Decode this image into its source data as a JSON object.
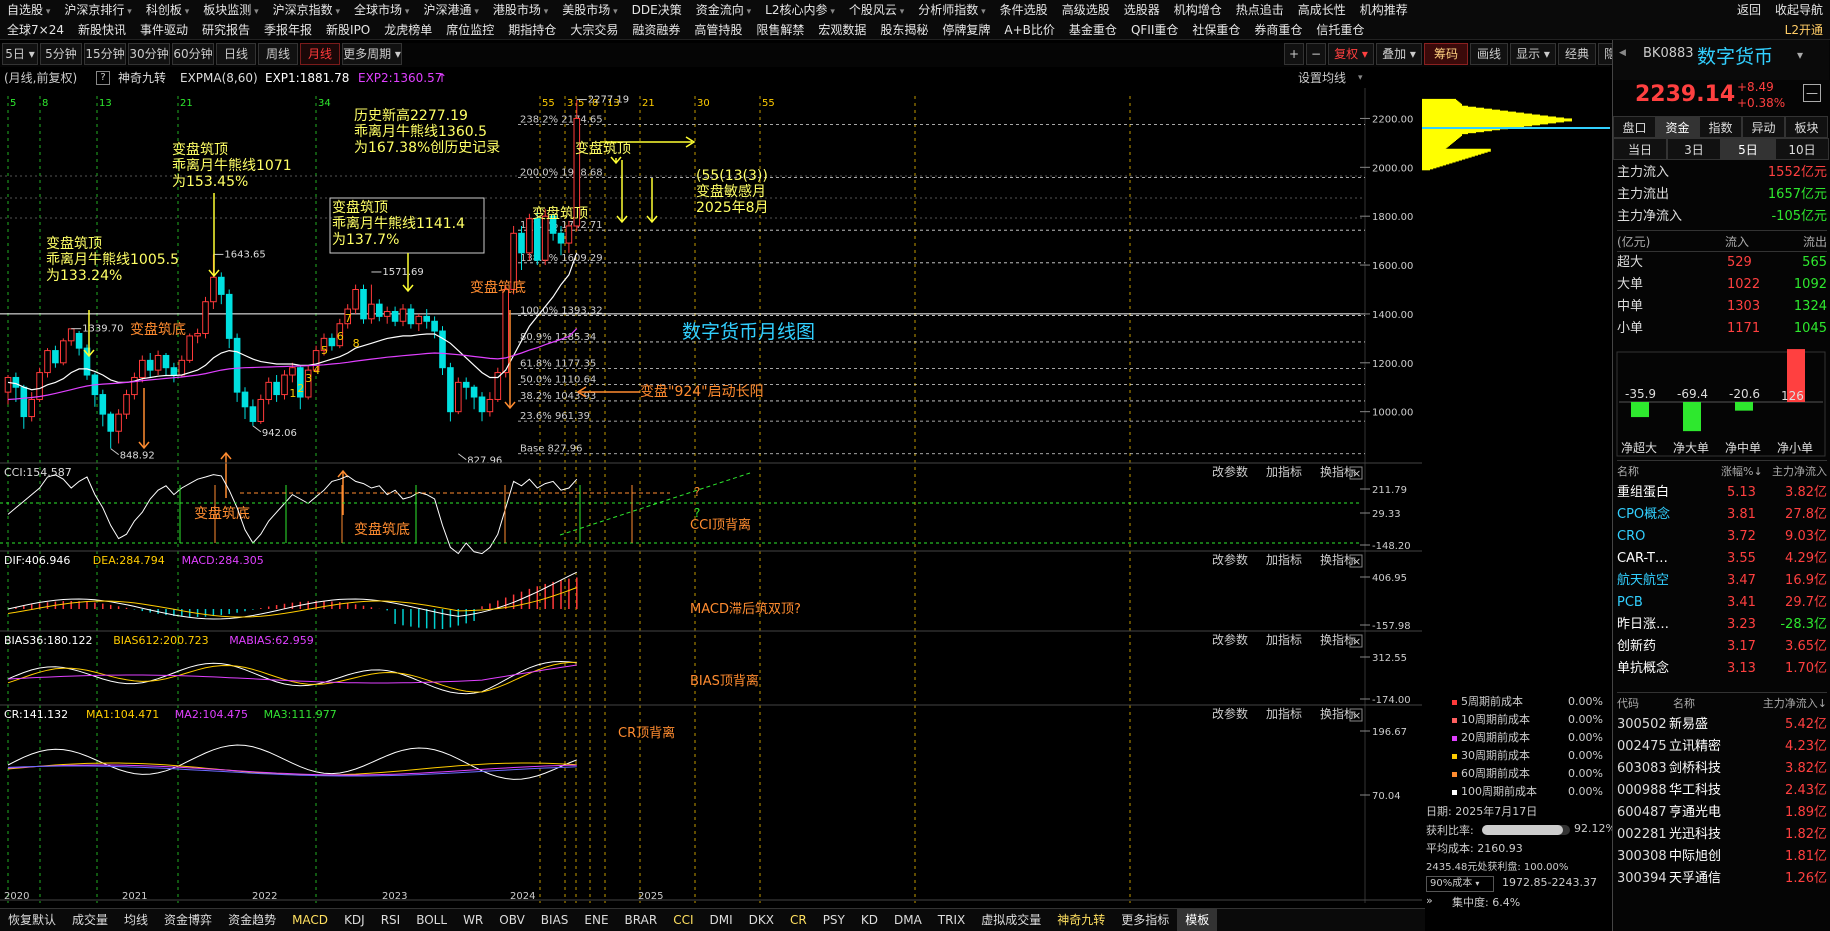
{
  "topmenu": {
    "row1": [
      "自选股",
      "沪深京排行",
      "科创板",
      "板块监测",
      "沪深京指数",
      "全球市场",
      "沪深港通",
      "港股市场",
      "美股市场",
      "DDE决策",
      "资金流向",
      "L2核心内参",
      "个股风云",
      "分析师指数",
      "条件选股",
      "高级选股",
      "选股器",
      "机构增仓",
      "热点追击",
      "高成长性",
      "机构推荐",
      "收起导航",
      "返回"
    ],
    "row2": [
      "全球7×24",
      "新股快讯",
      "事件驱动",
      "研究报告",
      "季报年报",
      "新股IPO",
      "龙虎榜单",
      "席位监控",
      "期指持仓",
      "大宗交易",
      "融资融券",
      "高管持股",
      "限售解禁",
      "宏观数据",
      "股东揭秘",
      "停牌复牌",
      "A+B比价",
      "基金重仓",
      "QFII重仓",
      "社保重仓",
      "券商重仓",
      "信托重仓",
      "L2开通"
    ],
    "row1_arrows": [
      0,
      1,
      2,
      3,
      4,
      5,
      6,
      7,
      8,
      10,
      11,
      12,
      13
    ]
  },
  "toolbar": {
    "periods": [
      "5日",
      "5分钟",
      "15分钟",
      "30分钟",
      "60分钟",
      "日线",
      "周线",
      "月线",
      "更多周期"
    ],
    "active_period": "月线",
    "right": [
      "+",
      "−",
      "复权",
      "叠加",
      "筹码",
      "画线",
      "显示",
      "经典",
      "隐藏"
    ],
    "right_active": "筹码"
  },
  "header": {
    "mode": "(月线,前复权)",
    "question": "?",
    "indicator": "神奇九转",
    "expma": "EXPMA(8,60)",
    "exp1": "EXP1:1881.78",
    "exp2": "EXP2:1360.57",
    "settings": "设置均线"
  },
  "chart_data": {
    "type": "candlestick",
    "title": "数字货币月线图",
    "xlabel_ticks": [
      "2020",
      "2021",
      "2022",
      "2023",
      "2024",
      "2025"
    ],
    "y_ticks": [
      "2200.00",
      "2000.00",
      "1800.00",
      "1600.00",
      "1400.00",
      "1200.00",
      "1000.00"
    ],
    "ylim": [
      790,
      2300
    ],
    "price_line": 1400,
    "candles": [
      [
        1080,
        1140,
        1030,
        1150
      ],
      [
        1140,
        1100,
        1040,
        1160
      ],
      [
        1100,
        980,
        930,
        1110
      ],
      [
        980,
        1050,
        960,
        1080
      ],
      [
        1050,
        1160,
        1040,
        1180
      ],
      [
        1160,
        1250,
        1140,
        1260
      ],
      [
        1250,
        1200,
        1180,
        1270
      ],
      [
        1200,
        1290,
        1190,
        1300
      ],
      [
        1290,
        1339,
        1270,
        1340
      ],
      [
        1320,
        1260,
        1230,
        1330
      ],
      [
        1260,
        1150,
        1130,
        1275
      ],
      [
        1150,
        1070,
        1020,
        1160
      ],
      [
        1070,
        990,
        940,
        1090
      ],
      [
        990,
        920,
        850,
        1000
      ],
      [
        920,
        990,
        870,
        1010
      ],
      [
        990,
        1070,
        970,
        1090
      ],
      [
        1070,
        1140,
        1050,
        1160
      ],
      [
        1140,
        1210,
        1120,
        1230
      ],
      [
        1210,
        1170,
        1140,
        1240
      ],
      [
        1170,
        1230,
        1150,
        1250
      ],
      [
        1230,
        1180,
        1150,
        1240
      ],
      [
        1180,
        1150,
        1120,
        1200
      ],
      [
        1150,
        1210,
        1140,
        1230
      ],
      [
        1210,
        1310,
        1200,
        1320
      ],
      [
        1310,
        1320,
        1280,
        1340
      ],
      [
        1320,
        1450,
        1300,
        1470
      ],
      [
        1450,
        1550,
        1420,
        1643
      ],
      [
        1550,
        1480,
        1440,
        1570
      ],
      [
        1480,
        1300,
        1260,
        1500
      ],
      [
        1300,
        1080,
        1040,
        1320
      ],
      [
        1080,
        1020,
        970,
        1100
      ],
      [
        1020,
        960,
        942,
        1050
      ],
      [
        960,
        1050,
        950,
        1070
      ],
      [
        1050,
        1120,
        1030,
        1140
      ],
      [
        1120,
        1070,
        1040,
        1150
      ],
      [
        1070,
        1150,
        1050,
        1170
      ],
      [
        1150,
        1180,
        1120,
        1200
      ],
      [
        1180,
        1060,
        1010,
        1190
      ],
      [
        1060,
        1170,
        1050,
        1190
      ],
      [
        1170,
        1250,
        1160,
        1270
      ],
      [
        1250,
        1300,
        1230,
        1320
      ],
      [
        1300,
        1270,
        1250,
        1320
      ],
      [
        1270,
        1360,
        1260,
        1380
      ],
      [
        1360,
        1420,
        1340,
        1440
      ],
      [
        1420,
        1500,
        1400,
        1520
      ],
      [
        1500,
        1380,
        1360,
        1520
      ],
      [
        1380,
        1440,
        1360,
        1520
      ],
      [
        1440,
        1390,
        1370,
        1460
      ],
      [
        1390,
        1410,
        1360,
        1430
      ],
      [
        1410,
        1370,
        1350,
        1430
      ],
      [
        1370,
        1420,
        1350,
        1440
      ],
      [
        1420,
        1360,
        1340,
        1440
      ],
      [
        1360,
        1390,
        1330,
        1400
      ],
      [
        1390,
        1370,
        1340,
        1420
      ],
      [
        1370,
        1330,
        1300,
        1390
      ],
      [
        1330,
        1180,
        1150,
        1350
      ],
      [
        1180,
        1000,
        960,
        1200
      ],
      [
        1000,
        1120,
        990,
        1140
      ],
      [
        1120,
        1100,
        1050,
        1140
      ],
      [
        1100,
        1060,
        1010,
        1110
      ],
      [
        1060,
        1000,
        961,
        1080
      ],
      [
        1000,
        1050,
        980,
        1080
      ],
      [
        1050,
        1160,
        1040,
        1180
      ],
      [
        1160,
        1500,
        1140,
        1520
      ],
      [
        1500,
        1730,
        1480,
        1760
      ],
      [
        1730,
        1650,
        1580,
        1760
      ],
      [
        1650,
        1790,
        1620,
        1810
      ],
      [
        1790,
        1620,
        1600,
        1820
      ],
      [
        1620,
        1800,
        1600,
        1830
      ],
      [
        1800,
        1730,
        1700,
        1810
      ],
      [
        1730,
        1690,
        1640,
        1760
      ],
      [
        1690,
        1760,
        1650,
        1780
      ],
      [
        1760,
        2200,
        1740,
        2277
      ]
    ],
    "exp1": [
      1120,
      1115,
      1100,
      1090,
      1095,
      1110,
      1120,
      1135,
      1160,
      1175,
      1175,
      1165,
      1150,
      1130,
      1120,
      1120,
      1125,
      1135,
      1140,
      1145,
      1148,
      1148,
      1150,
      1160,
      1170,
      1190,
      1220,
      1240,
      1250,
      1245,
      1230,
      1215,
      1205,
      1200,
      1195,
      1195,
      1195,
      1190,
      1190,
      1195,
      1205,
      1215,
      1225,
      1240,
      1260,
      1270,
      1280,
      1290,
      1300,
      1305,
      1310,
      1310,
      1315,
      1318,
      1318,
      1300,
      1280,
      1250,
      1220,
      1190,
      1160,
      1140,
      1140,
      1170,
      1230,
      1290,
      1350,
      1390,
      1430,
      1470,
      1520,
      1560,
      1650
    ],
    "exp2": [
      1050,
      1052,
      1055,
      1058,
      1062,
      1068,
      1075,
      1082,
      1090,
      1098,
      1105,
      1110,
      1113,
      1115,
      1117,
      1120,
      1123,
      1127,
      1130,
      1133,
      1136,
      1139,
      1142,
      1146,
      1150,
      1156,
      1163,
      1170,
      1175,
      1178,
      1180,
      1181,
      1182,
      1183,
      1184,
      1185,
      1186,
      1187,
      1188,
      1190,
      1192,
      1195,
      1198,
      1202,
      1207,
      1211,
      1215,
      1219,
      1223,
      1226,
      1229,
      1232,
      1235,
      1238,
      1240,
      1239,
      1236,
      1233,
      1230,
      1226,
      1222,
      1218,
      1216,
      1220,
      1230,
      1240,
      1252,
      1262,
      1274,
      1285,
      1296,
      1308,
      1340
    ],
    "fib_levels": [
      [
        "238.2%",
        2174.65
      ],
      [
        "200.0%",
        1958.68
      ],
      [
        "161.8%",
        1742.71
      ],
      [
        "138.2%",
        1609.29
      ],
      [
        "100.0%",
        1393.32
      ],
      [
        "80.9%",
        1285.34
      ],
      [
        "61.8%",
        1177.35
      ],
      [
        "50.0%",
        1110.64
      ],
      [
        "38.2%",
        1043.93
      ],
      [
        "23.6%",
        961.39
      ],
      [
        "Base",
        827.96
      ]
    ],
    "peak_labels": [
      [
        "1339.70",
        8,
        1339.7
      ],
      [
        "1643.65",
        26,
        1643.65
      ],
      [
        "1571.69",
        46,
        1571.69
      ],
      [
        "2277.19",
        72,
        2277.19
      ]
    ],
    "trough_labels": [
      [
        "848.92",
        13,
        848.92
      ],
      [
        "942.06",
        31,
        942.06
      ],
      [
        "827.96",
        57,
        827.96
      ]
    ],
    "annotations": {
      "a1": [
        "变盘筑顶",
        "乖离月牛熊线1005.5",
        "为133.24%"
      ],
      "a2": [
        "变盘筑顶",
        "乖离月牛熊线1071",
        "为153.45%"
      ],
      "a3": [
        "变盘筑顶",
        "乖离月牛熊线1141.4",
        "为137.7%"
      ],
      "a4": [
        "历史新高2277.19",
        "乖离月牛熊线1360.5",
        "为167.38%创历史记录"
      ],
      "a5": [
        "(55(13(3))",
        "变盘敏感月",
        "2025年8月"
      ],
      "bottom": "变盘筑底",
      "top": "变盘筑顶",
      "n924": "变盘\"924\"启动长阳"
    },
    "nine_count": [
      "1",
      "2",
      "3",
      "4",
      "5",
      "6",
      "7",
      "8"
    ],
    "fib_cycle_top": [
      "5",
      "8",
      "13",
      "21",
      "34",
      "55",
      "3",
      "5",
      "8",
      "13",
      "21",
      "30",
      "55"
    ]
  },
  "panels": {
    "cci": {
      "label": "CCI:154.587",
      "yticks": [
        "211.79",
        "29.33",
        "-148.20"
      ],
      "note": "CCI顶背离",
      "q": "?",
      "q2": "?"
    },
    "macd": {
      "label1": "DIF:406.946",
      "label2": "DEA:284.794",
      "label3": "MACD:284.305",
      "yticks": [
        "406.95",
        "-157.98"
      ],
      "note": "MACD滞后筑双顶?"
    },
    "bias": {
      "label1": "BIAS36:180.122",
      "label2": "BIAS612:200.723",
      "label3": "MABIAS:62.959",
      "yticks": [
        "312.55",
        "-174.00"
      ],
      "note": "BIAS顶背离"
    },
    "cr": {
      "label1": "CR:141.132",
      "label2": "MA1:104.471",
      "label3": "MA2:104.475",
      "label4": "MA3:111.977",
      "yticks": [
        "196.67",
        "70.04"
      ],
      "note": "CR顶背离"
    },
    "tools": [
      "改参数",
      "加指标",
      "换指标"
    ],
    "close": "×"
  },
  "bottombar": [
    "恢复默认",
    "成交量",
    "均线",
    "资金博弈",
    "资金趋势",
    "MACD",
    "KDJ",
    "RSI",
    "BOLL",
    "WR",
    "OBV",
    "BIAS",
    "ENE",
    "BRAR",
    "CCI",
    "DMI",
    "DKX",
    "CR",
    "PSY",
    "KD",
    "DMA",
    "TRIX",
    "虚拟成交量",
    "神奇九转",
    "更多指标",
    "模板"
  ],
  "vprofile": {
    "legend": [
      [
        "5周期前成本",
        "0.00%"
      ],
      [
        "10周期前成本",
        "0.00%"
      ],
      [
        "20周期前成本",
        "0.00%"
      ],
      [
        "30周期前成本",
        "0.00%"
      ],
      [
        "60周期前成本",
        "0.00%"
      ],
      [
        "100周期前成本",
        "0.00%"
      ]
    ],
    "date": "日期: 2025年7月17日",
    "profit_label": "获利比率:",
    "profit_val": "92.12%",
    "profit_ratio": 0.9212,
    "avg": "平均成本: 2160.93",
    "at": "2435.48元处获利盘: 100.00%",
    "cost_sel": "90%成本",
    "cost_range": "1972.85-2243.37",
    "conc": "集中度: 6.4%"
  },
  "side": {
    "code": "BK0883",
    "name": "数字货币",
    "price": "2239.14",
    "chg": "+8.49",
    "pct": "+0.38%",
    "tabs1": [
      "盘口",
      "资金",
      "指数",
      "异动",
      "板块"
    ],
    "tabs1_active": "资金",
    "tabs2": [
      "当日",
      "3日",
      "5日",
      "10日"
    ],
    "tabs2_active": "5日",
    "flow": [
      [
        "主力流入",
        "1552亿元",
        "red"
      ],
      [
        "主力流出",
        "1657亿元",
        "grn"
      ],
      [
        "主力净流入",
        "-105亿元",
        "grn"
      ]
    ],
    "tbl_head": [
      "(亿元)",
      "流入",
      "流出"
    ],
    "tbl": [
      [
        "超大",
        "529",
        "565"
      ],
      [
        "大单",
        "1022",
        "1092"
      ],
      [
        "中单",
        "1303",
        "1324"
      ],
      [
        "小单",
        "1171",
        "1045"
      ]
    ],
    "bars": [
      [
        "-35.9",
        -35.9
      ],
      [
        "-69.4",
        -69.4
      ],
      [
        "-20.6",
        -20.6
      ],
      [
        "126",
        126
      ]
    ],
    "bar_labels": [
      "净超大",
      "净大单",
      "净中单",
      "净小单"
    ],
    "sec_head": [
      "名称",
      "涨幅%↓",
      "主力净流入"
    ],
    "sectors": [
      [
        "重组蛋白",
        "5.13",
        "3.82亿",
        "#fff"
      ],
      [
        "CPO概念",
        "3.81",
        "27.8亿",
        "#32d0ff"
      ],
      [
        "CRO",
        "3.72",
        "9.03亿",
        "#32d0ff"
      ],
      [
        "CAR-T…",
        "3.55",
        "4.29亿",
        "#fff"
      ],
      [
        "航天航空",
        "3.47",
        "16.9亿",
        "#32d0ff"
      ],
      [
        "PCB",
        "3.41",
        "29.7亿",
        "#32d0ff"
      ],
      [
        "昨日涨…",
        "3.23",
        "-28.3亿",
        "#fff"
      ],
      [
        "创新药",
        "3.17",
        "3.65亿",
        "#fff"
      ],
      [
        "单抗概念",
        "3.13",
        "1.70亿",
        "#fff"
      ]
    ],
    "stock_head": [
      "代码",
      "名称",
      "主力净流入↓"
    ],
    "stocks": [
      [
        "300502",
        "新易盛",
        "5.42亿"
      ],
      [
        "002475",
        "立讯精密",
        "4.23亿"
      ],
      [
        "603083",
        "剑桥科技",
        "3.82亿"
      ],
      [
        "000988",
        "华工科技",
        "2.43亿"
      ],
      [
        "600487",
        "亨通光电",
        "1.89亿"
      ],
      [
        "002281",
        "光迅科技",
        "1.82亿"
      ],
      [
        "300308",
        "中际旭创",
        "1.81亿"
      ],
      [
        "300394",
        "天孚通信",
        "1.26亿"
      ]
    ]
  }
}
